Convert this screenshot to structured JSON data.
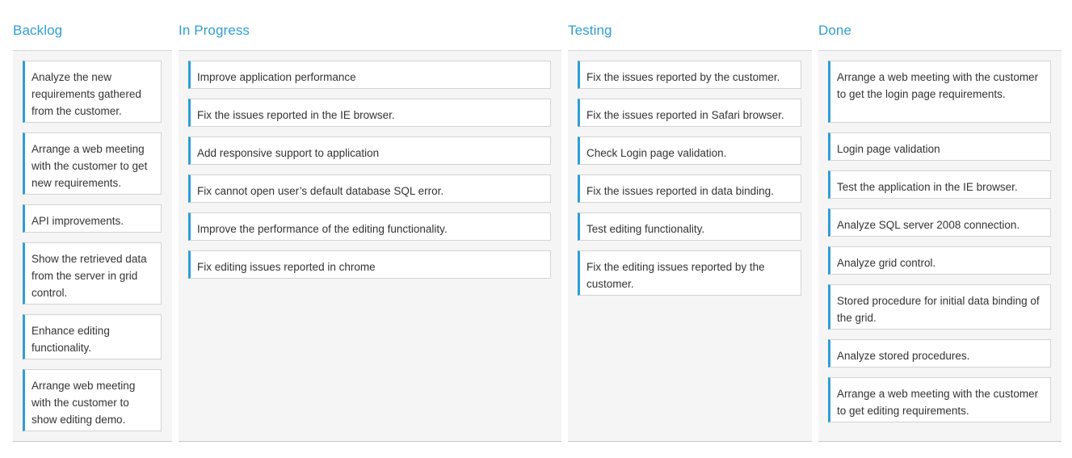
{
  "board": {
    "accent_color": "#2e9ed6",
    "columns": [
      {
        "title": "Backlog",
        "cards": [
          {
            "text": "Analyze the new requirements gathered from the customer."
          },
          {
            "text": "Arrange a web meeting with the customer to get new requirements."
          },
          {
            "text": "API improvements."
          },
          {
            "text": "Show the retrieved data from the server in grid control."
          },
          {
            "text": "Enhance editing functionality."
          },
          {
            "text": "Arrange web meeting with the customer to show editing demo."
          }
        ]
      },
      {
        "title": "In Progress",
        "cards": [
          {
            "text": "Improve application performance"
          },
          {
            "text": "Fix the issues reported in the IE browser."
          },
          {
            "text": "Add responsive support to application"
          },
          {
            "text": "Fix cannot open user’s default database SQL error."
          },
          {
            "text": "Improve the performance of the editing functionality."
          },
          {
            "text": "Fix editing issues reported in chrome"
          }
        ]
      },
      {
        "title": "Testing",
        "cards": [
          {
            "text": "Fix the issues reported by the customer."
          },
          {
            "text": "Fix the issues reported in Safari browser."
          },
          {
            "text": "Check Login page validation."
          },
          {
            "text": "Fix the issues reported in data binding."
          },
          {
            "text": "Test editing functionality."
          },
          {
            "text": "Fix the editing issues reported by the customer."
          }
        ]
      },
      {
        "title": "Done",
        "cards": [
          {
            "text": "Arrange a web meeting with the customer to get the login page requirements."
          },
          {
            "text": "Login page validation"
          },
          {
            "text": "Test the application in the IE browser."
          },
          {
            "text": "Analyze SQL server 2008 connection."
          },
          {
            "text": "Analyze grid control."
          },
          {
            "text": "Stored procedure for initial data binding of the grid."
          },
          {
            "text": "Analyze stored procedures."
          },
          {
            "text": "Arrange a web meeting with the customer to get editing requirements."
          }
        ]
      }
    ]
  }
}
